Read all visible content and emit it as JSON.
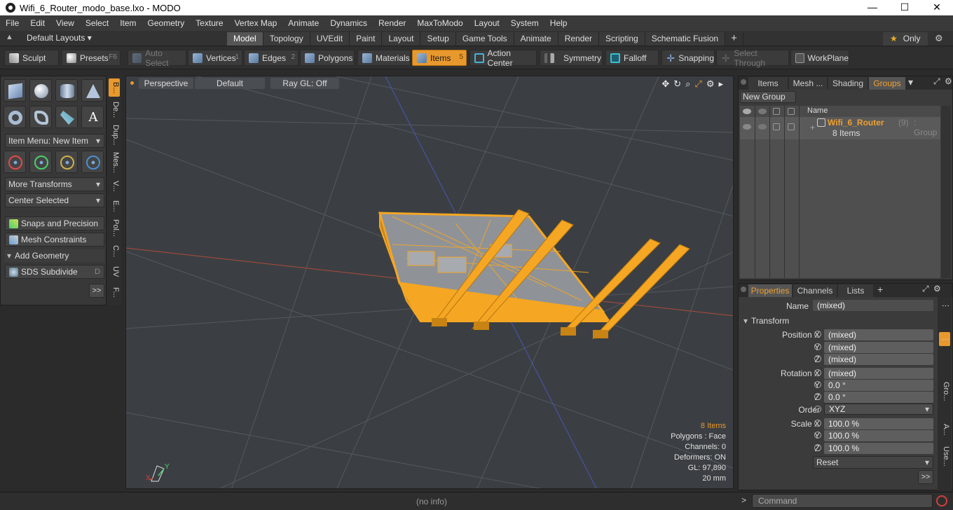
{
  "window": {
    "title": "Wifi_6_Router_modo_base.lxo - MODO",
    "controls": [
      "—",
      "☐",
      "✕"
    ]
  },
  "menu": [
    "File",
    "Edit",
    "View",
    "Select",
    "Item",
    "Geometry",
    "Texture",
    "Vertex Map",
    "Animate",
    "Dynamics",
    "Render",
    "MaxToModo",
    "Layout",
    "System",
    "Help"
  ],
  "layout_bar": {
    "default_layouts": "Default Layouts ▾",
    "tabs": [
      "Model",
      "Topology",
      "UVEdit",
      "Paint",
      "Layout",
      "Setup",
      "Game Tools",
      "Animate",
      "Render",
      "Scripting",
      "Schematic Fusion"
    ],
    "active_tab": "Model",
    "only_label": "Only"
  },
  "toolbar": {
    "sculpt": "Sculpt",
    "presets": "Presets",
    "presets_hotkey": "F6",
    "auto_select": "Auto Select",
    "vertices": "Vertices",
    "vertices_key": "1",
    "edges": "Edges",
    "edges_key": "2",
    "polygons": "Polygons",
    "materials": "Materials",
    "items": "Items",
    "items_key": "5",
    "action_center": "Action Center",
    "symmetry": "Symmetry",
    "falloff": "Falloff",
    "snapping": "Snapping",
    "select_through": "Select Through",
    "workplane": "WorkPlane"
  },
  "left_panel": {
    "item_menu": "Item Menu: New Item",
    "more_transforms": "More Transforms",
    "center_selected": "Center Selected",
    "snaps_precision": "Snaps and Precision",
    "mesh_constraints": "Mesh Constraints",
    "add_geometry": "Add Geometry",
    "sds_subdivide": "SDS Subdivide",
    "sds_key": "D",
    "more": ">>",
    "vtabs": [
      "B...",
      "De...",
      "Dup...",
      "Mes...",
      "V...",
      "E...",
      "Pol...",
      "C...",
      "UV",
      "F..."
    ]
  },
  "viewport": {
    "perspective": "Perspective",
    "default": "Default",
    "raygl": "Ray GL: Off",
    "info": {
      "items": "8 Items",
      "polygons": "Polygons : Face",
      "channels": "Channels: 0",
      "deformers": "Deformers: ON",
      "gl": "GL: 97,890",
      "scale": "20 mm"
    },
    "axis_x": "X",
    "axis_y": "Y"
  },
  "groups_panel": {
    "tabs": [
      "Items",
      "Mesh ...",
      "Shading",
      "Groups"
    ],
    "active_tab": "Groups",
    "new_group": "New Group",
    "col_name": "Name",
    "group_name": "Wifi_6_Router",
    "group_count": "(9)",
    "group_type": ": Group",
    "group_items": "8 Items"
  },
  "properties_panel": {
    "tabs": [
      "Properties",
      "Channels",
      "Lists"
    ],
    "active_tab": "Properties",
    "name_label": "Name",
    "name_value": "(mixed)",
    "transform": "Transform",
    "position_label": "Position X",
    "rotation_label": "Rotation X",
    "order_label": "Order",
    "scale_label": "Scale X",
    "y_label": "Y",
    "z_label": "Z",
    "pos_x": "(mixed)",
    "pos_y": "(mixed)",
    "pos_z": "(mixed)",
    "rot_x": "(mixed)",
    "rot_y": "0.0 °",
    "rot_z": "0.0 °",
    "order_value": "XYZ",
    "scale_x": "100.0 %",
    "scale_y": "100.0 %",
    "scale_z": "100.0 %",
    "reset": "Reset",
    "more": ">>",
    "vtabs": [
      "Gro...",
      "A...",
      "Use..."
    ]
  },
  "statusbar": {
    "info": "(no info)",
    "command_placeholder": "Command",
    "arrow": ">"
  },
  "colors": {
    "accent": "#e8992e",
    "viewport_bg": "#3b3f43",
    "model_wire": "#f5a623"
  }
}
